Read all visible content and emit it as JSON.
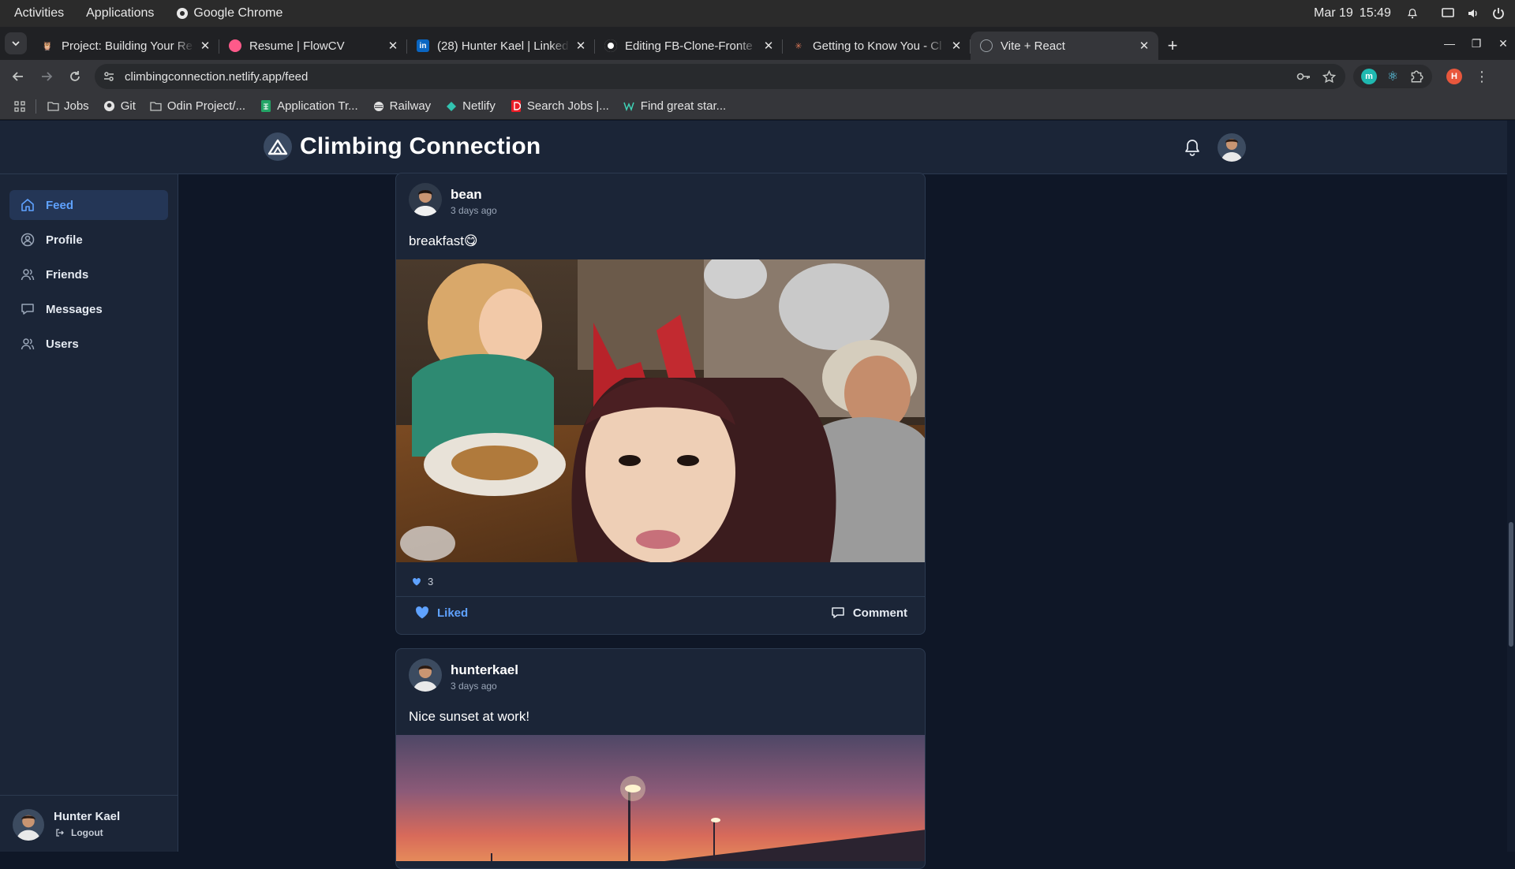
{
  "system_bar": {
    "activities": "Activities",
    "applications": "Applications",
    "app_name": "Google Chrome",
    "date": "Mar 19",
    "time": "15:49"
  },
  "browser": {
    "tabs": [
      {
        "title": "Project: Building Your Re",
        "icon": "odin-icon",
        "color": "#d9a441"
      },
      {
        "title": "Resume | FlowCV",
        "icon": "flowcv-icon",
        "color": "#ff5a8a"
      },
      {
        "title": "(28) Hunter Kael | Linked",
        "icon": "linkedin-icon",
        "color": "#0a66c2"
      },
      {
        "title": "Editing FB-Clone-Fronte",
        "icon": "github-icon",
        "color": "#ffffff"
      },
      {
        "title": "Getting to Know You - Cl",
        "icon": "claude-icon",
        "color": "#d97757"
      },
      {
        "title": "Vite + React",
        "icon": "globe-icon",
        "color": "#9aa0a6"
      }
    ],
    "active_tab": 5,
    "url": "climbingconnection.netlify.app/feed",
    "bookmarks": [
      {
        "label": "Jobs",
        "icon": "folder-icon"
      },
      {
        "label": "Git",
        "icon": "github-icon"
      },
      {
        "label": "Odin Project/...",
        "icon": "folder-icon"
      },
      {
        "label": "Application Tr...",
        "icon": "sheets-icon"
      },
      {
        "label": "Railway",
        "icon": "railway-icon"
      },
      {
        "label": "Netlify",
        "icon": "netlify-icon"
      },
      {
        "label": "Search Jobs |...",
        "icon": "dice-icon"
      },
      {
        "label": "Find great star...",
        "icon": "wellfound-icon"
      }
    ],
    "profile_initial": "H"
  },
  "app": {
    "brand": "Climbing Connection",
    "nav": [
      {
        "label": "Feed",
        "icon": "home-icon",
        "active": true
      },
      {
        "label": "Profile",
        "icon": "profile-icon",
        "active": false
      },
      {
        "label": "Friends",
        "icon": "friends-icon",
        "active": false
      },
      {
        "label": "Messages",
        "icon": "messages-icon",
        "active": false
      },
      {
        "label": "Users",
        "icon": "users-icon",
        "active": false
      }
    ],
    "user": {
      "name": "Hunter Kael",
      "logout": "Logout"
    },
    "accent": "#5fa2ff",
    "posts": [
      {
        "author": "bean",
        "time": "3 days ago",
        "text": "breakfast😋",
        "likes": "3",
        "like_label": "Liked",
        "comment_label": "Comment",
        "image": "breakfast-selfie-photo"
      },
      {
        "author": "hunterkael",
        "time": "3 days ago",
        "text": "Nice sunset at work!",
        "image": "sunset-photo"
      }
    ]
  }
}
